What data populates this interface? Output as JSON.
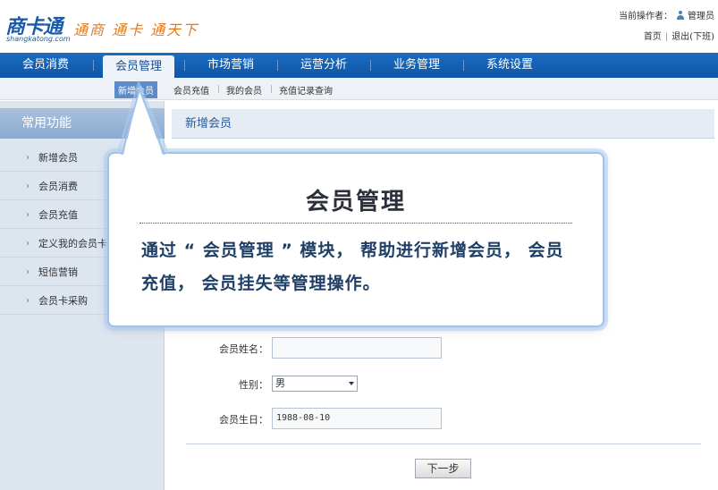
{
  "brand": {
    "logo_text": "商卡通",
    "logo_sub": "shangkatong.com",
    "slogan": "通商 通卡 通天下"
  },
  "header": {
    "operator_label": "当前操作者：",
    "operator_name": "管理员",
    "home_link": "首页",
    "logout_link": "退出(下班)"
  },
  "nav": {
    "items": [
      "会员消费",
      "会员管理",
      "市场营销",
      "运营分析",
      "业务管理",
      "系统设置"
    ],
    "active": "会员管理"
  },
  "subnav": {
    "items": [
      "新增会员",
      "会员充值",
      "我的会员",
      "充值记录查询"
    ]
  },
  "sidebar": {
    "title": "常用功能",
    "items": [
      "新增会员",
      "会员消费",
      "会员充值",
      "定义我的会员卡",
      "短信营销",
      "会员卡采购"
    ]
  },
  "content": {
    "title": "新增会员"
  },
  "form": {
    "name_label": "会员姓名：",
    "name_value": "",
    "gender_label": "性别：",
    "gender_value": "男",
    "birthday_label": "会员生日：",
    "birthday_value": "1988-08-10",
    "next_button": "下一步"
  },
  "callout": {
    "title": "会员管理",
    "body": "通过 “ 会员管理 ” 模块， 帮助进行新增会员， 会员充值， 会员挂失等管理操作。"
  },
  "colors": {
    "nav_blue": "#1c6cc0",
    "accent_orange": "#e07a20",
    "callout_border": "#9fc3ea"
  }
}
